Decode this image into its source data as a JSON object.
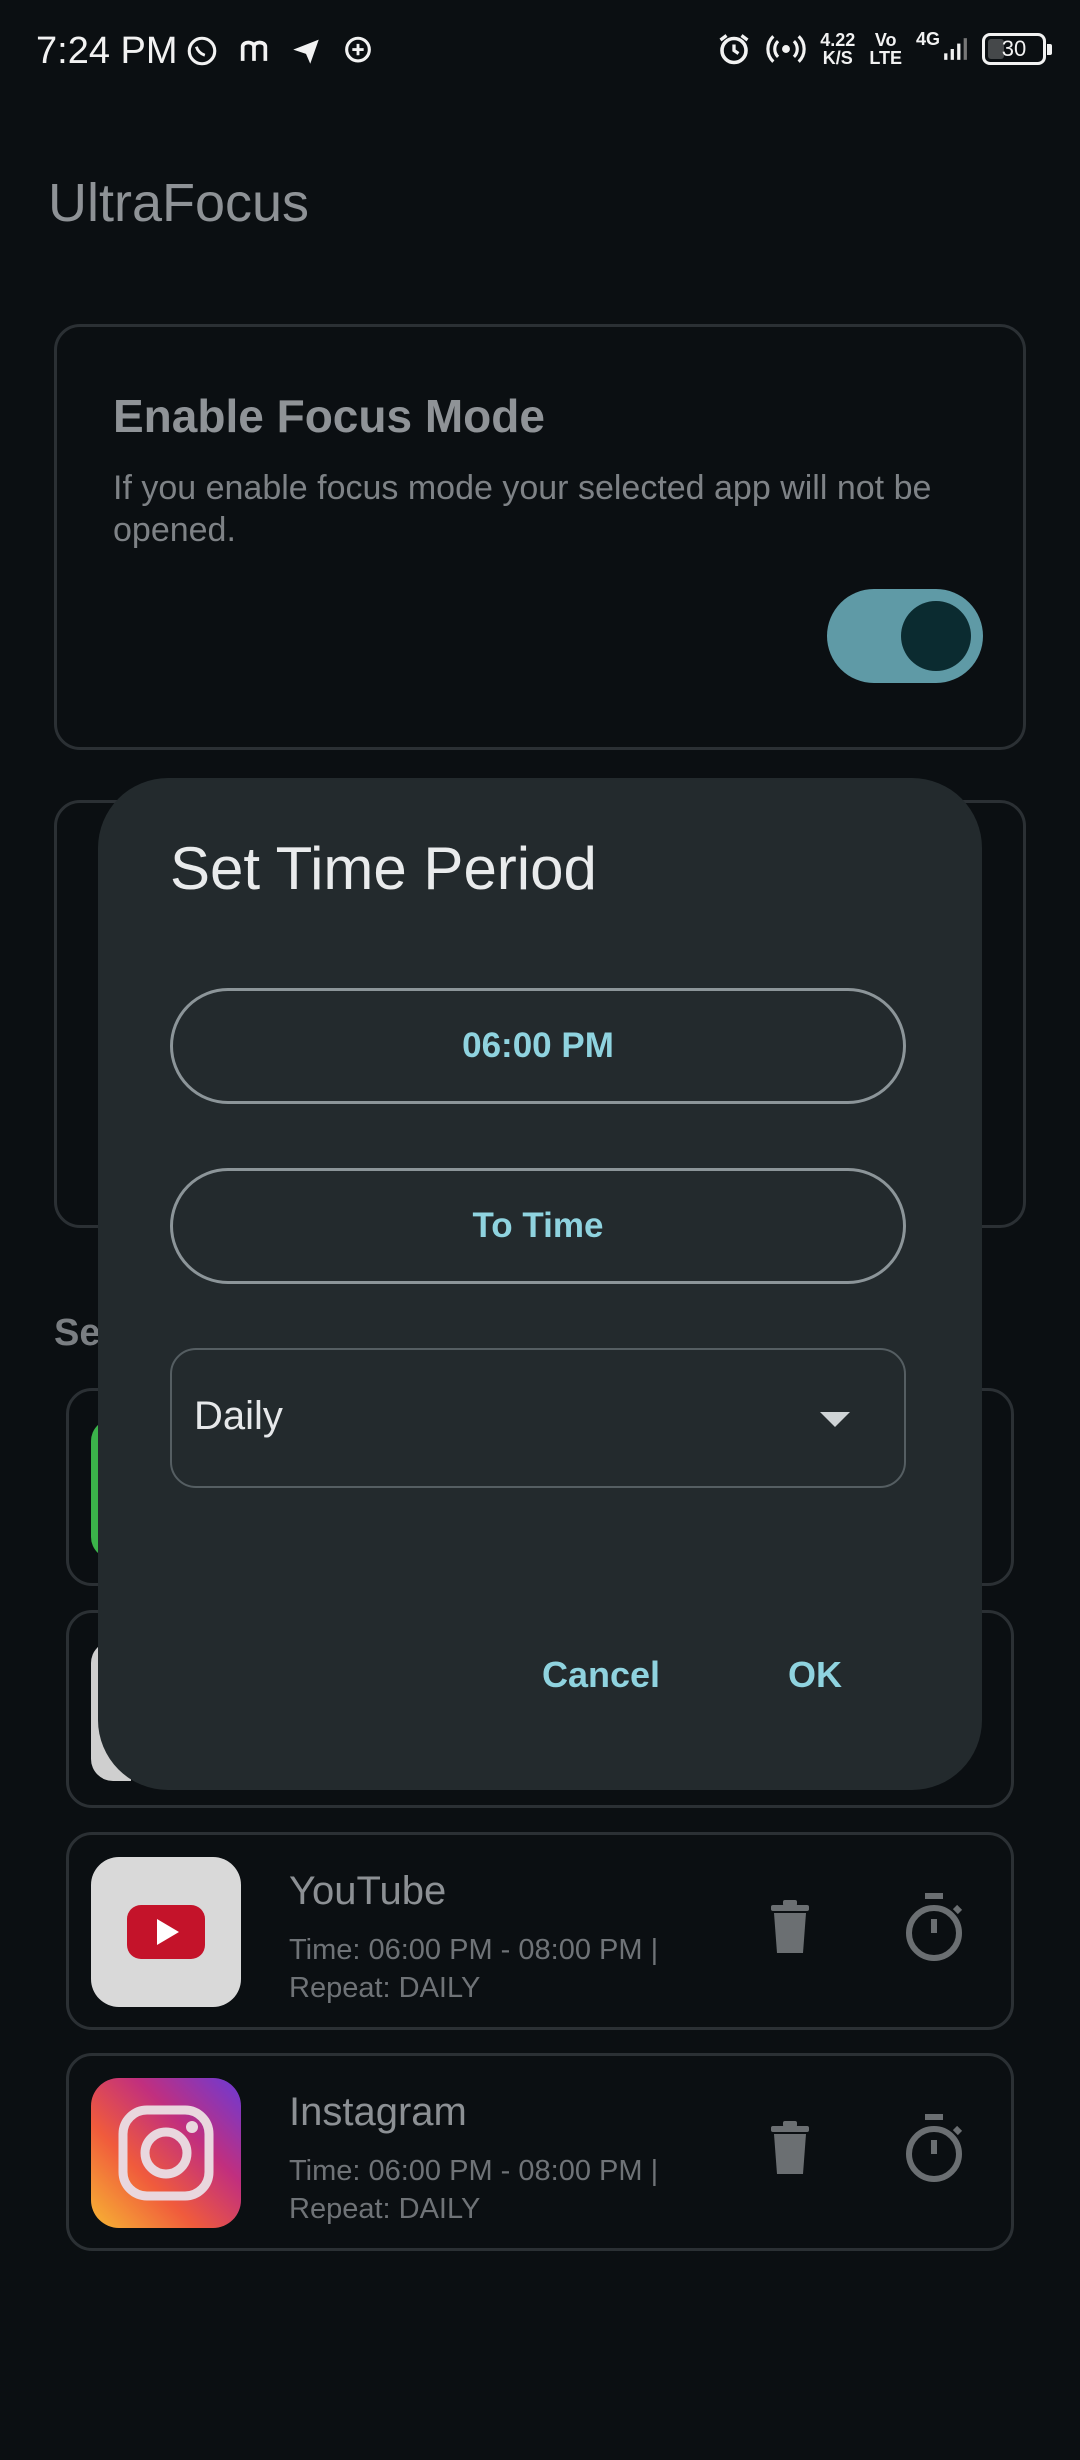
{
  "status_bar": {
    "time": "7:24 PM",
    "net_speed_top": "4.22",
    "net_speed_bottom": "K/S",
    "volte_top": "Vo",
    "volte_bottom": "LTE",
    "network": "4G",
    "battery": "30"
  },
  "app": {
    "title": "UltraFocus"
  },
  "focus_card": {
    "title": "Enable Focus Mode",
    "description": "If you enable focus mode your selected app will not be opened.",
    "enabled": true
  },
  "selected_section": {
    "label_visible": "Se"
  },
  "apps": [
    {
      "name": "YouTube",
      "time": "Time: 06:00 PM - 08:00 PM |",
      "repeat": "Repeat: DAILY"
    },
    {
      "name": "Instagram",
      "time": "Time: 06:00 PM - 08:00 PM |",
      "repeat": "Repeat: DAILY"
    }
  ],
  "dialog": {
    "title": "Set Time Period",
    "from_time": "06:00 PM",
    "to_time": "To Time",
    "repeat_value": "Daily",
    "cancel": "Cancel",
    "ok": "OK"
  },
  "colors": {
    "accent": "#8fd3df",
    "toggle_track": "#5f9aa6",
    "dialog_bg": "#232a2d",
    "page_bg": "#0b0f12"
  }
}
